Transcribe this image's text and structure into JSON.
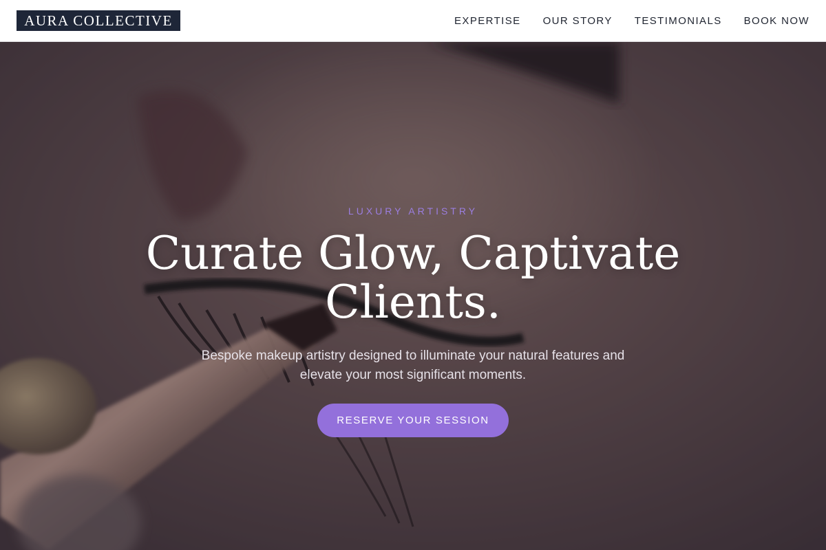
{
  "brand": {
    "name": "AURA COLLECTIVE"
  },
  "nav": {
    "items": [
      {
        "label": "EXPERTISE"
      },
      {
        "label": "OUR STORY"
      },
      {
        "label": "TESTIMONIALS"
      },
      {
        "label": "BOOK NOW"
      }
    ]
  },
  "hero": {
    "eyebrow": "LUXURY ARTISTRY",
    "headline": "Curate Glow, Captivate Clients.",
    "subtext": "Bespoke makeup artistry designed to illuminate your natural features and elevate your most significant moments.",
    "cta_label": "RESERVE YOUR SESSION"
  },
  "colors": {
    "accent": "#9370db",
    "logo_bg": "#1e2638",
    "nav_text": "#1f2430",
    "eyebrow": "#9b7ee0"
  }
}
